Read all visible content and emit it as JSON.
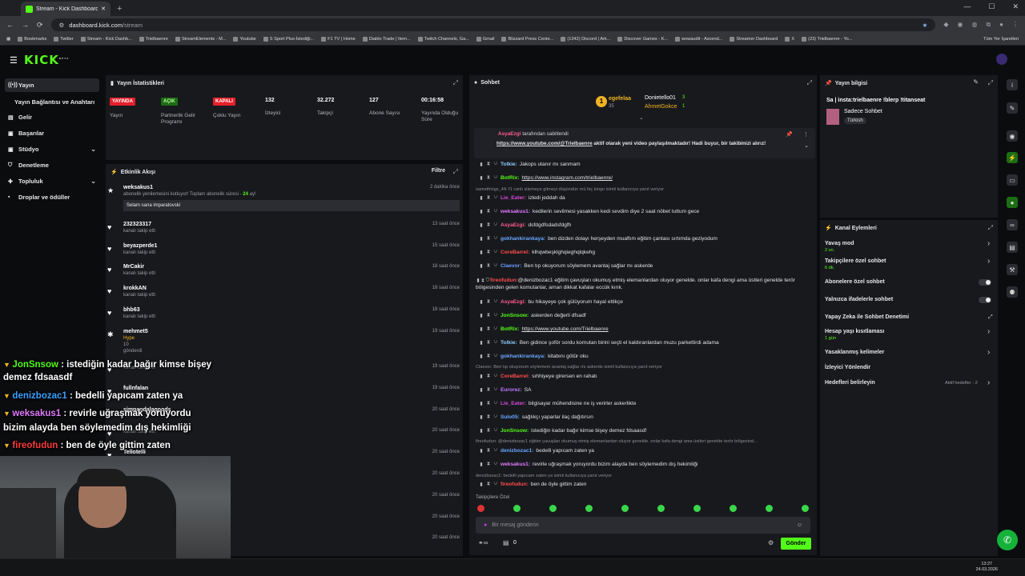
{
  "browser": {
    "tab_title": "Stream - Kick Dashboard",
    "url_host": "dashboard.kick.com",
    "url_path": "/stream",
    "bookmarks": [
      "Bookmarks",
      "Twitter",
      "Stream - Kick Dashb...",
      "Trielbaenre",
      "StreamElements - M...",
      "Youtube",
      "S Sport Plus-İstediği...",
      "F1 TV | Home",
      "Diablo Trade | Item...",
      "Twitch Channels, Ga...",
      "Gmail",
      "Blizzard Press Cente...",
      "(1342) Discord | Ark...",
      "Discover Games - K...",
      "wowaudit - Ascend...",
      "Streamer Dashboard",
      "X",
      "(23) Trielbaenre - Yo..."
    ],
    "all_bookmarks": "Tüm Yer İşaretleri"
  },
  "sidebar": {
    "items": [
      {
        "label": "Yayın"
      },
      {
        "label": "Yayın Bağlantısı ve Anahtarı"
      },
      {
        "label": "Gelir"
      },
      {
        "label": "Başarılar"
      },
      {
        "label": "Stüdyo"
      },
      {
        "label": "Denetleme"
      },
      {
        "label": "Topluluk"
      },
      {
        "label": "Droplar ve ödüller"
      }
    ]
  },
  "stats": {
    "title": "Yayın İstatistikleri",
    "badges": [
      {
        "text": "YAYINDA",
        "label": "Yayın"
      },
      {
        "text": "AÇIK",
        "label": "Partnerlik Gelir Programı"
      },
      {
        "text": "KAPALI",
        "label": "Çoklu Yayın"
      }
    ],
    "numbers": [
      {
        "value": "132",
        "label": "İzleyici"
      },
      {
        "value": "32.272",
        "label": "Takipçi"
      },
      {
        "value": "127",
        "label": "Abone Sayısı"
      },
      {
        "value": "00:16:58",
        "label": "Yayında Olduğu Süre"
      }
    ]
  },
  "activity": {
    "title": "Etkinlik Akışı",
    "filter": "Filtre",
    "items": [
      {
        "name": "weksakus1",
        "sub_a": "abonelik yenilemesini kutluyor! Toplam abonelik süresi - ",
        "sub_b": "24",
        "sub_c": " ay!",
        "time": "2 dakika önce",
        "message": "Selam sana imparatovski"
      },
      {
        "name": "232323317",
        "sub": "kanalı takip etti",
        "time": "13 saat önce"
      },
      {
        "name": "beyazperde1",
        "sub": "kanalı takip etti",
        "time": "15 saat önce"
      },
      {
        "name": "MrCakir",
        "sub": "kanalı takip etti",
        "time": "18 saat önce"
      },
      {
        "name": "krokkAN",
        "sub": "kanalı takip etti",
        "time": "18 saat önce"
      },
      {
        "name": "bhb63",
        "sub": "kanalı takip etti",
        "time": "18 saat önce"
      },
      {
        "name": "mehmet5",
        "hype": "Hype",
        "amount": "10",
        "sub": "gönderdi",
        "time": "19 saat önce"
      },
      {
        "name": "",
        "sub": "kanalı takip etti",
        "time": "19 saat önce"
      },
      {
        "name": "fullnfalan",
        "sub": "",
        "time": "19 saat önce"
      },
      {
        "name": "simpandalagoods",
        "sub": "",
        "time": "20 saat önce"
      },
      {
        "name": "",
        "sub": "kanalı takip etti",
        "time": "20 saat önce"
      },
      {
        "name": "Tellotelli",
        "sub": "",
        "time": "20 saat önce"
      },
      {
        "name": "",
        "sub": "",
        "time": "20 saat önce"
      },
      {
        "name": "",
        "sub": "",
        "time": "20 saat önce"
      },
      {
        "name": "",
        "sub": "",
        "time": "20 saat önce"
      },
      {
        "name": "",
        "sub": "",
        "time": "20 saat önce"
      }
    ]
  },
  "chat": {
    "title": "Sohbet",
    "leaderboard": [
      {
        "name": "egefelaa",
        "count": "35"
      },
      {
        "name": "Donietello01",
        "count": "3"
      },
      {
        "name": "AhmetGokce",
        "count": "1"
      }
    ],
    "pinned_by": "AsyaEzgi",
    "pinned_by_suffix": "tarafından sabitlendi",
    "pinned_link": "https://www.youtube.com/@Trielbaenre",
    "pinned_text": " aktif olarak yeni video paylaşılmaktadır! Hadi buyur, bir takibinizi alırız!",
    "messages": [
      {
        "user": "Tolkie:",
        "color": "#8ecbff",
        "text": "Jakops utanır mı sanmam"
      },
      {
        "user": "BotRix:",
        "color": "#53fc18",
        "text": "",
        "link": "https://www.instagram.com/trielbaenre/"
      },
      {
        "reply": "samethings_44: f1 canlı izlemeye gitmeyi düşündün mü hiç kingo isimli kullanıcıya yanıt veriyor"
      },
      {
        "user": "Lie_Eater:",
        "color": "#d54bd8",
        "text": "izledi jeddah da"
      },
      {
        "user": "weksakus1:",
        "color": "#e07bff",
        "text": "kedilerin sevilmesi yasakken kedi sevdim diye 2 saat nöbet tuttum gece"
      },
      {
        "user": "AsyaEzgi:",
        "color": "#ff5c8a",
        "text": "dsfdgdfsdadsfdgfh"
      },
      {
        "user": "gokhankirankaya:",
        "color": "#6aa7ff",
        "text": "ben dizden dolayı herşeyden muaftım eğitim çantası sırtımda geziyodum"
      },
      {
        "user": "CoreBarrel:",
        "color": "#ff4d4d",
        "text": "klhqwbeşklghqieghqlqkehg"
      },
      {
        "user": "Claevor:",
        "color": "#6a9cff",
        "text": "Ben tıp okuyorum söylemem avantaj sağlar mı askerde"
      },
      {
        "user": "fireofudun:",
        "color": "#ff4d4d",
        "text": "@denizbozac1 eğitim çavuşları okumuş etmiş elemanlardan oluyor genelde. onlar kafa dengi ama üstleri genelde terör bölgesinden gelen komutanlar, aman dikkat kafalar eccük kırık."
      },
      {
        "user": "AsyaEzgi:",
        "color": "#ff5c8a",
        "text": "bu hikayeye çok gülüyorum hayal ettikçe"
      },
      {
        "user": "JonSnsow:",
        "color": "#53fc18",
        "text": "askerden değerli dfsadf"
      },
      {
        "user": "BotRix:",
        "color": "#53fc18",
        "text": "",
        "link": "https://www.youtube.com/Trielbaenre"
      },
      {
        "user": "Tolkie:",
        "color": "#8ecbff",
        "text": "Ben gidince şoför sordu komutan birini seçti el kaldıranlardan muzu parkettirdi adama"
      },
      {
        "user": "gokhankirankaya:",
        "color": "#6aa7ff",
        "text": "kitabını götür oku"
      },
      {
        "reply": "Claevor: Ben tıp okuyorum söylemem avantaj sağlar mı askerde isimli kullanıcıya yanıt veriyor"
      },
      {
        "user": "CoreBarrel:",
        "color": "#ff4d4d",
        "text": "sıhhiyeye girersen en rahatı"
      },
      {
        "user": "Eurorez:",
        "color": "#c07bff",
        "text": "SA"
      },
      {
        "user": "Lie_Eater:",
        "color": "#d54bd8",
        "text": "bilgisayar mühendisine ne iş verirler askerlikte"
      },
      {
        "user": "Sulo05:",
        "color": "#6aa7ff",
        "text": "sağlıkçı yaparlar ilaç dağıtırsın"
      },
      {
        "user": "JonSnsow:",
        "color": "#53fc18",
        "text": "istediğin kadar bağır kimse bişey demez fdsaasdf"
      },
      {
        "reply": "fireofudun: @denizbozac1 eğitim çavuşları okumuş etmiş elemanlardan oluyor genelde. onlar kafa dengi ama üstleri genelde terör bölgesind..."
      },
      {
        "user": "denizbozac1:",
        "color": "#6aa7ff",
        "text": "bedelli yapıcam zaten ya"
      },
      {
        "user": "weksakus1:",
        "color": "#e07bff",
        "text": "revirle uğraşmak yoruyordu bizim alayda ben söylemedim dış hekimliği"
      },
      {
        "reply": "denizbozac1: bedelli yapıcam zaten ya isimli kullanıcıya yanıt veriyor"
      },
      {
        "user": "fireofudun:",
        "color": "#ff4d4d",
        "text": "ben de öyle gittim zaten"
      }
    ],
    "followers_only": "Takipçilere Özel",
    "input_placeholder": "Bir mesaj gönderin",
    "points": "0",
    "send": "Gönder"
  },
  "stream_info": {
    "title": "Yayın bilgisi",
    "stream_title": "Sa | insta:trielbaenre !blerp !titanseat",
    "category": "Sadece Sohbet",
    "tag": "Türkish"
  },
  "channel_actions": {
    "title": "Kanal Eylemleri",
    "items": [
      {
        "label": "Yavaş mod",
        "sub": "2 sn."
      },
      {
        "label": "Takipçilere özel sohbet",
        "sub": "6 dk."
      },
      {
        "label": "Abonelere özel sohbet"
      },
      {
        "label": "Yalnızca ifadelerle sohbet"
      },
      {
        "label": "Yapay Zeka ile Sohbet Denetimi"
      },
      {
        "label": "Hesap yaşı kısıtlaması",
        "sub": "1 gün"
      },
      {
        "label": "Yasaklanmış kelimeler"
      },
      {
        "label": "İzleyici Yönlendir"
      },
      {
        "label": "Hedefleri belirleyin",
        "extra": "Aktif hedefler - 2"
      }
    ]
  },
  "overlay": {
    "lines": [
      {
        "user": "JonSnsow",
        "text": " : istediğin kadar bağır kimse bişey",
        "color": "#53fc18"
      },
      {
        "user": "",
        "text": "demez fdsaasdf",
        "color": "#fff"
      },
      {
        "user": "denizbozac1",
        "text": " : bedelli yapıcam zaten ya",
        "color": "#3aa0ff"
      },
      {
        "user": "weksakus1",
        "text": " : revirle uğraşmak yoruyordu",
        "color": "#e07bff"
      },
      {
        "user": "",
        "text": "bizim alayda ben söylemedim dış hekimliği",
        "color": "#fff"
      },
      {
        "user": "fireofudun",
        "text": " : ben de öyle gittim zaten",
        "color": "#ff3b3b"
      }
    ]
  },
  "taskbar": {
    "time": "13:27",
    "date": "24.03.2026"
  }
}
